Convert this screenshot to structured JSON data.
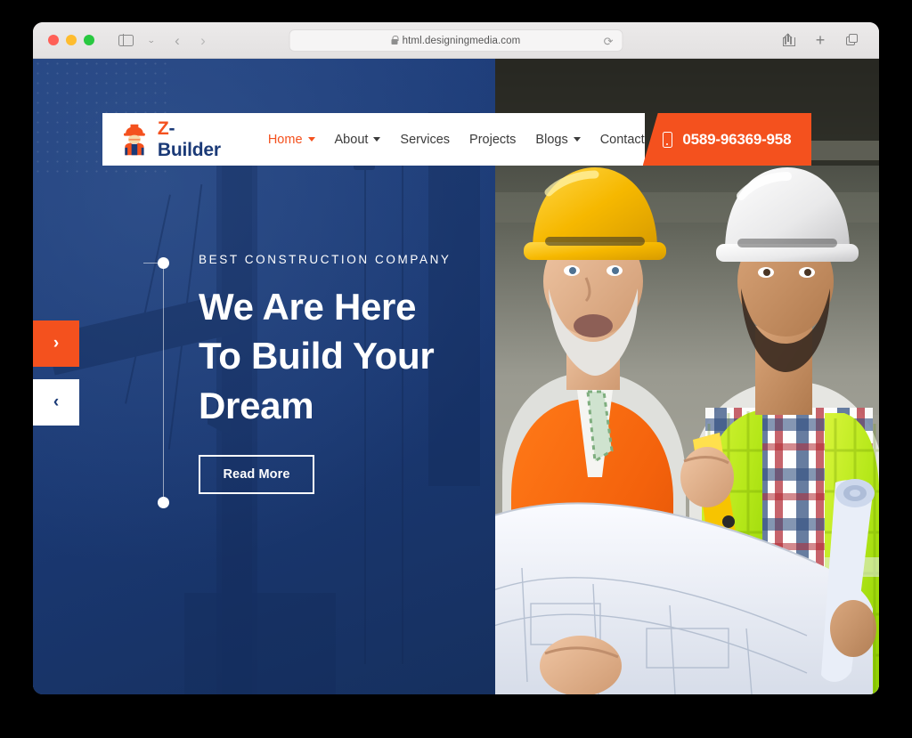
{
  "browser": {
    "traffic_lights": [
      "close",
      "minimize",
      "maximize"
    ],
    "sidebar_toggle": "sidebar-toggle",
    "back_label": "‹",
    "forward_label": "›",
    "url": "html.designingmedia.com",
    "reload_label": "⟳",
    "share_label": "share",
    "new_tab_label": "+",
    "tab_overview_label": "tabs"
  },
  "site": {
    "brand": {
      "letter": "Z",
      "rest": "-Builder",
      "logo_icon": "construction-worker-icon"
    },
    "nav": [
      {
        "label": "Home",
        "active": true,
        "has_dropdown": true
      },
      {
        "label": "About",
        "active": false,
        "has_dropdown": true
      },
      {
        "label": "Services",
        "active": false,
        "has_dropdown": false
      },
      {
        "label": "Projects",
        "active": false,
        "has_dropdown": false
      },
      {
        "label": "Blogs",
        "active": false,
        "has_dropdown": true
      },
      {
        "label": "Contact",
        "active": false,
        "has_dropdown": false
      }
    ],
    "phone": {
      "icon": "mobile-phone-icon",
      "number": "0589-96369-958"
    }
  },
  "hero": {
    "eyebrow": "BEST CONSTRUCTION COMPANY",
    "title_lines": [
      "We Are Here",
      "To Build Your",
      "Dream"
    ],
    "cta_label": "Read More",
    "slider": {
      "next_label": "›",
      "prev_label": "‹"
    },
    "image_alt": "Two construction workers in hard hats reviewing a blueprint"
  },
  "colors": {
    "accent_orange": "#f4511e",
    "brand_navy": "#1b3a77",
    "panel_blue": "#1b3a77",
    "white": "#ffffff"
  }
}
